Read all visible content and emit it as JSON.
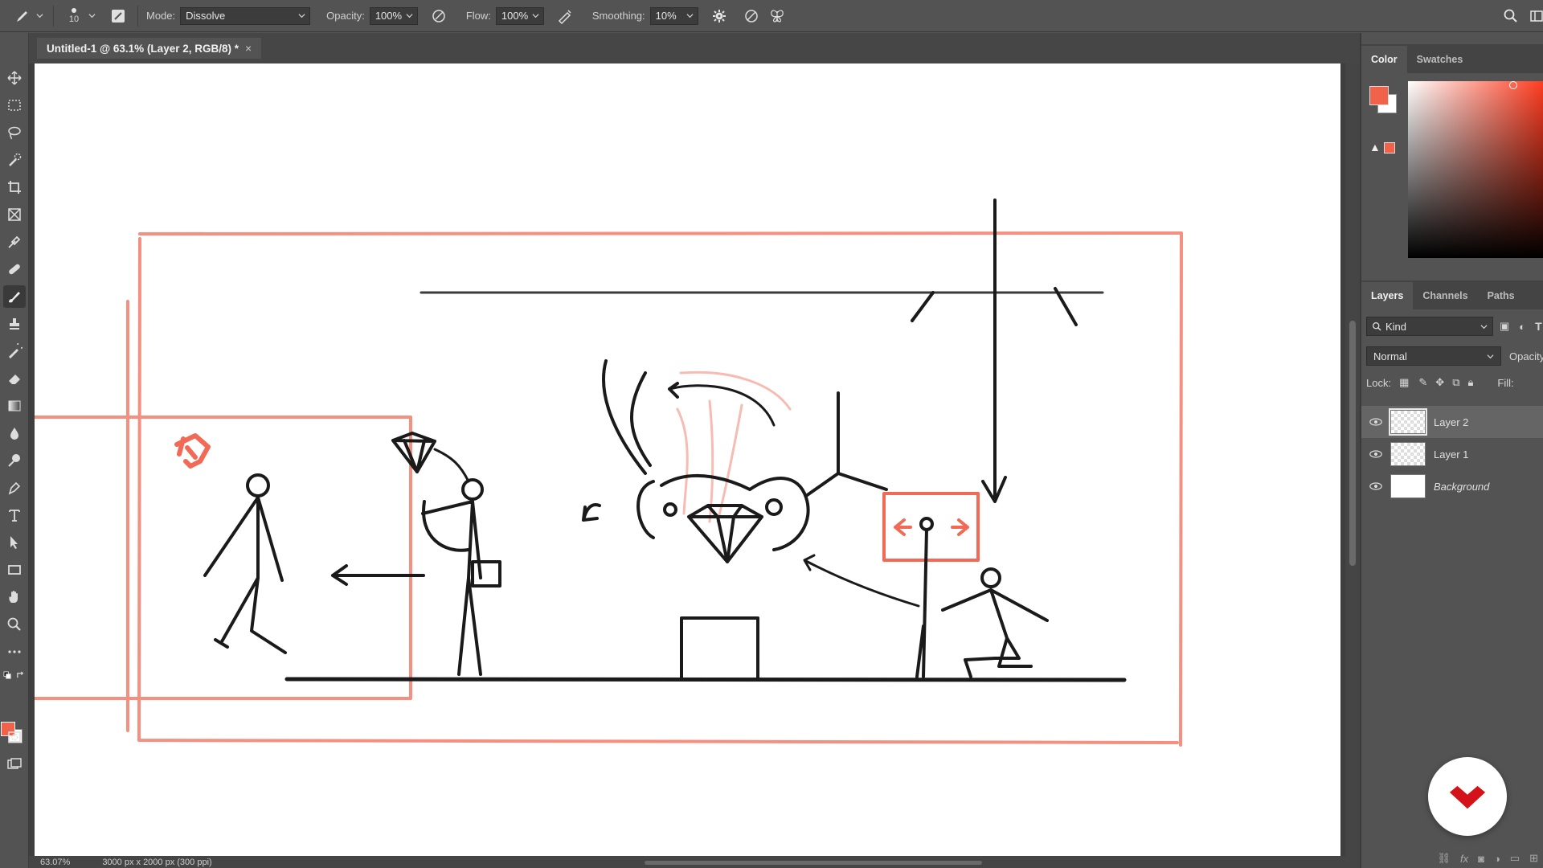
{
  "options": {
    "brush_size": "10",
    "mode_label": "Mode:",
    "mode_value": "Dissolve",
    "opacity_label": "Opacity:",
    "opacity_value": "100%",
    "flow_label": "Flow:",
    "flow_value": "100%",
    "smoothing_label": "Smoothing:",
    "smoothing_value": "10%"
  },
  "document": {
    "tab_title": "Untitled-1 @ 63.1% (Layer 2, RGB/8) *",
    "close_glyph": "×"
  },
  "status": {
    "zoom": "63.07%",
    "doc_size": "3000 px x 2000 px (300 ppi)"
  },
  "colors": {
    "foreground": "#f0624a",
    "background": "#ffffff",
    "sketch_red": "#f26a55",
    "sketch_black": "#1a1a1a"
  },
  "color_panel": {
    "tabs": [
      "Color",
      "Swatches"
    ],
    "active_tab": "Color"
  },
  "layers_panel": {
    "tabs": [
      "Layers",
      "Channels",
      "Paths"
    ],
    "kind_label": "Kind",
    "blend_mode": "Normal",
    "opacity_label": "Opacity:",
    "lock_label": "Lock:",
    "fill_label": "Fill:",
    "layers": [
      {
        "name": "Layer 2",
        "visible": true,
        "selected": true
      },
      {
        "name": "Layer 1",
        "visible": true,
        "selected": false
      },
      {
        "name": "Background",
        "visible": true,
        "selected": false
      }
    ]
  },
  "tools": [
    "move-tool",
    "marquee-tool",
    "lasso-tool",
    "quick-select-tool",
    "crop-tool",
    "frame-tool",
    "eyedropper-tool",
    "healing-tool",
    "brush-tool",
    "clone-stamp-tool",
    "history-brush-tool",
    "eraser-tool",
    "gradient-tool",
    "blur-tool",
    "dodge-tool",
    "pen-tool",
    "type-tool",
    "path-select-tool",
    "rectangle-tool",
    "hand-tool",
    "zoom-tool",
    "more-tools"
  ]
}
